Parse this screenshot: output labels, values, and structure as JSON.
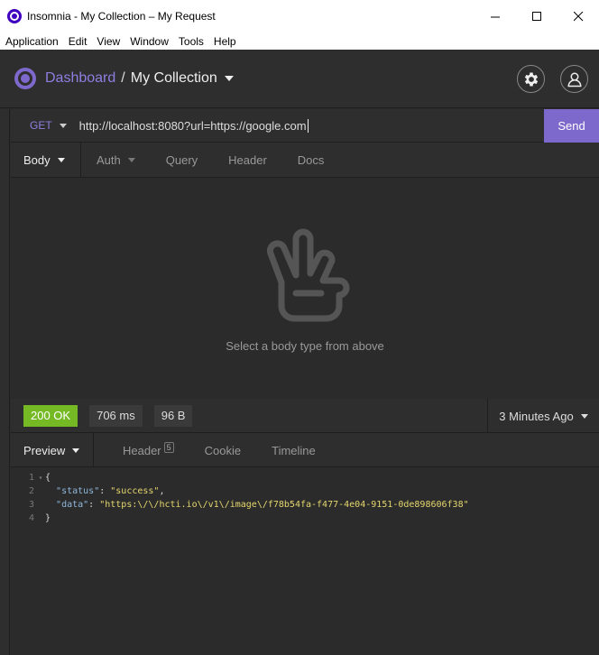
{
  "window": {
    "title": "Insomnia - My Collection – My Request"
  },
  "menu": [
    "Application",
    "Edit",
    "View",
    "Window",
    "Tools",
    "Help"
  ],
  "header": {
    "dashboard_label": "Dashboard",
    "separator": "/",
    "collection_label": "My Collection"
  },
  "request": {
    "method": "GET",
    "url": "http://localhost:8080?url=https://google.com",
    "send_label": "Send",
    "tabs": [
      "Body",
      "Auth",
      "Query",
      "Header",
      "Docs"
    ],
    "empty_message": "Select a body type from above"
  },
  "response": {
    "status": "200 OK",
    "time": "706 ms",
    "size": "96 B",
    "time_ago": "3 Minutes Ago",
    "tabs": [
      "Preview",
      "Header",
      "Cookie",
      "Timeline"
    ],
    "header_count": "5",
    "code_lines": {
      "l1": "{",
      "l2_key": "\"status\"",
      "l2_val": "\"success\"",
      "l3_key": "\"data\"",
      "l3_val": "\"https:\\/\\/hcti.io\\/v1\\/image\\/f78b54fa-f477-4e04-9151-0de898606f38\"",
      "l4": "}"
    },
    "line_numbers": [
      "1",
      "2",
      "3",
      "4"
    ]
  },
  "colors": {
    "accent": "#7d69cb",
    "status_ok": "#75ba24",
    "background": "#2b2b2b"
  }
}
